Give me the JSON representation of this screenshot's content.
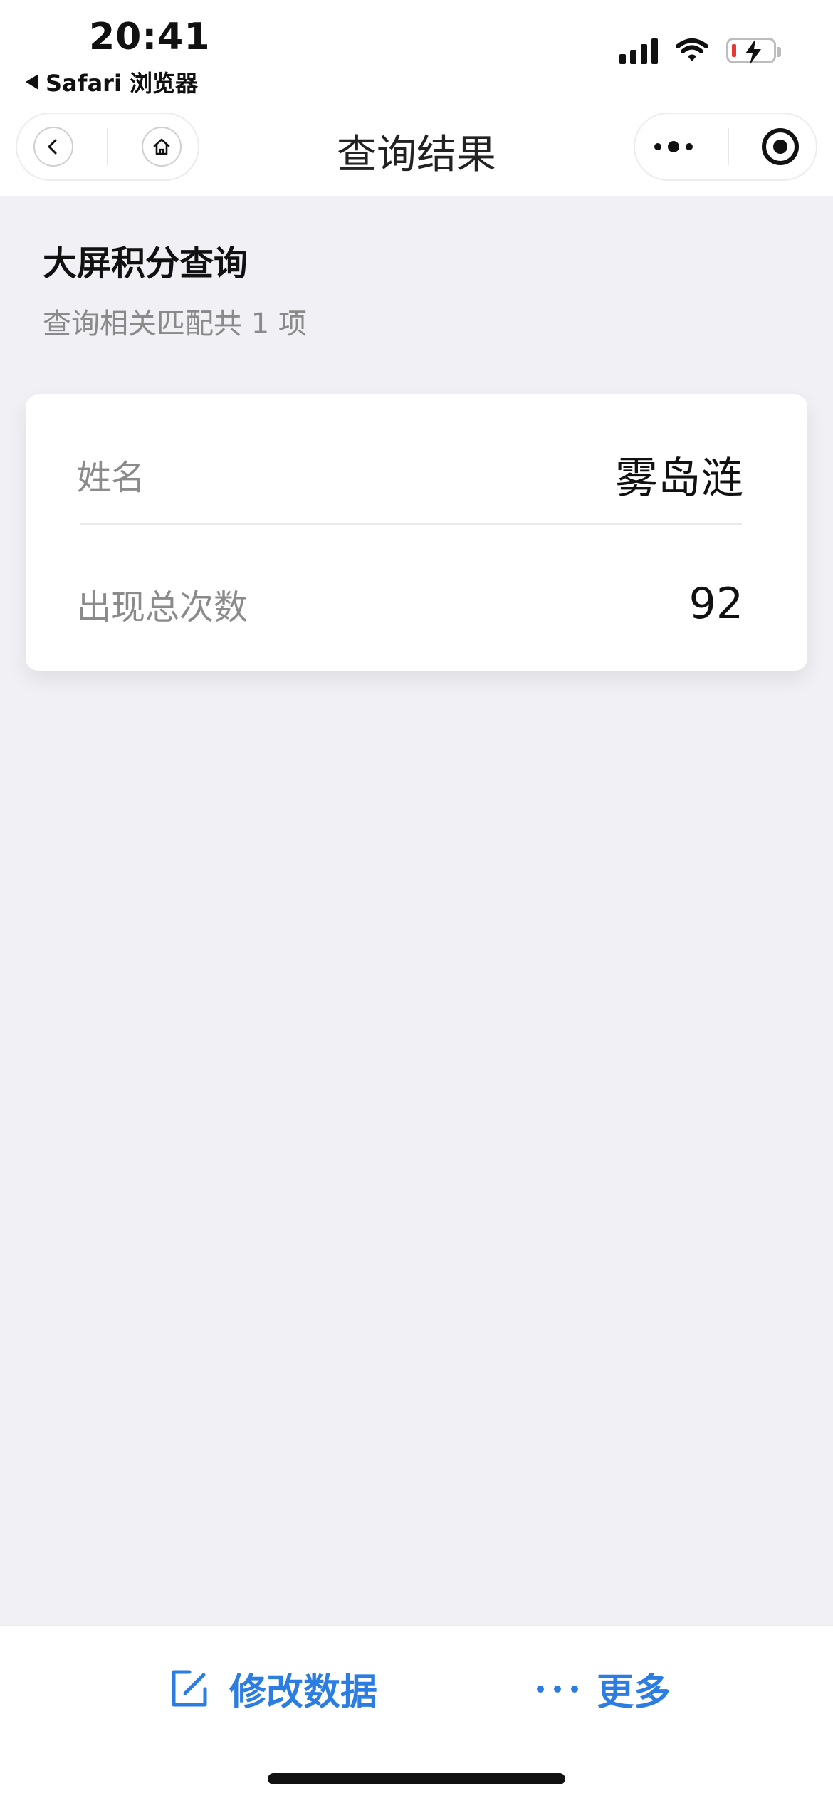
{
  "status_bar": {
    "time": "20:41",
    "back_app_label": "Safari 浏览器",
    "icons": [
      "signal-icon",
      "wifi-icon",
      "battery-charging-icon"
    ]
  },
  "nav": {
    "title": "查询结果",
    "left_icons": [
      "back-icon",
      "home-icon"
    ],
    "right_icons": [
      "more-icon",
      "record-icon"
    ]
  },
  "header": {
    "heading": "大屏积分查询",
    "subheading": "查询相关匹配共 1 项"
  },
  "result": {
    "rows": [
      {
        "label": "姓名",
        "value": "雾岛涟"
      },
      {
        "label": "出现总次数",
        "value": "92"
      }
    ]
  },
  "bottom_bar": {
    "edit_label": "修改数据",
    "more_label": "更多",
    "edit_icon": "edit-icon",
    "more_icon": "more-dots-icon"
  },
  "colors": {
    "accent": "#2b7de1",
    "background": "#f0f0f5",
    "battery_low": "#e53935"
  }
}
